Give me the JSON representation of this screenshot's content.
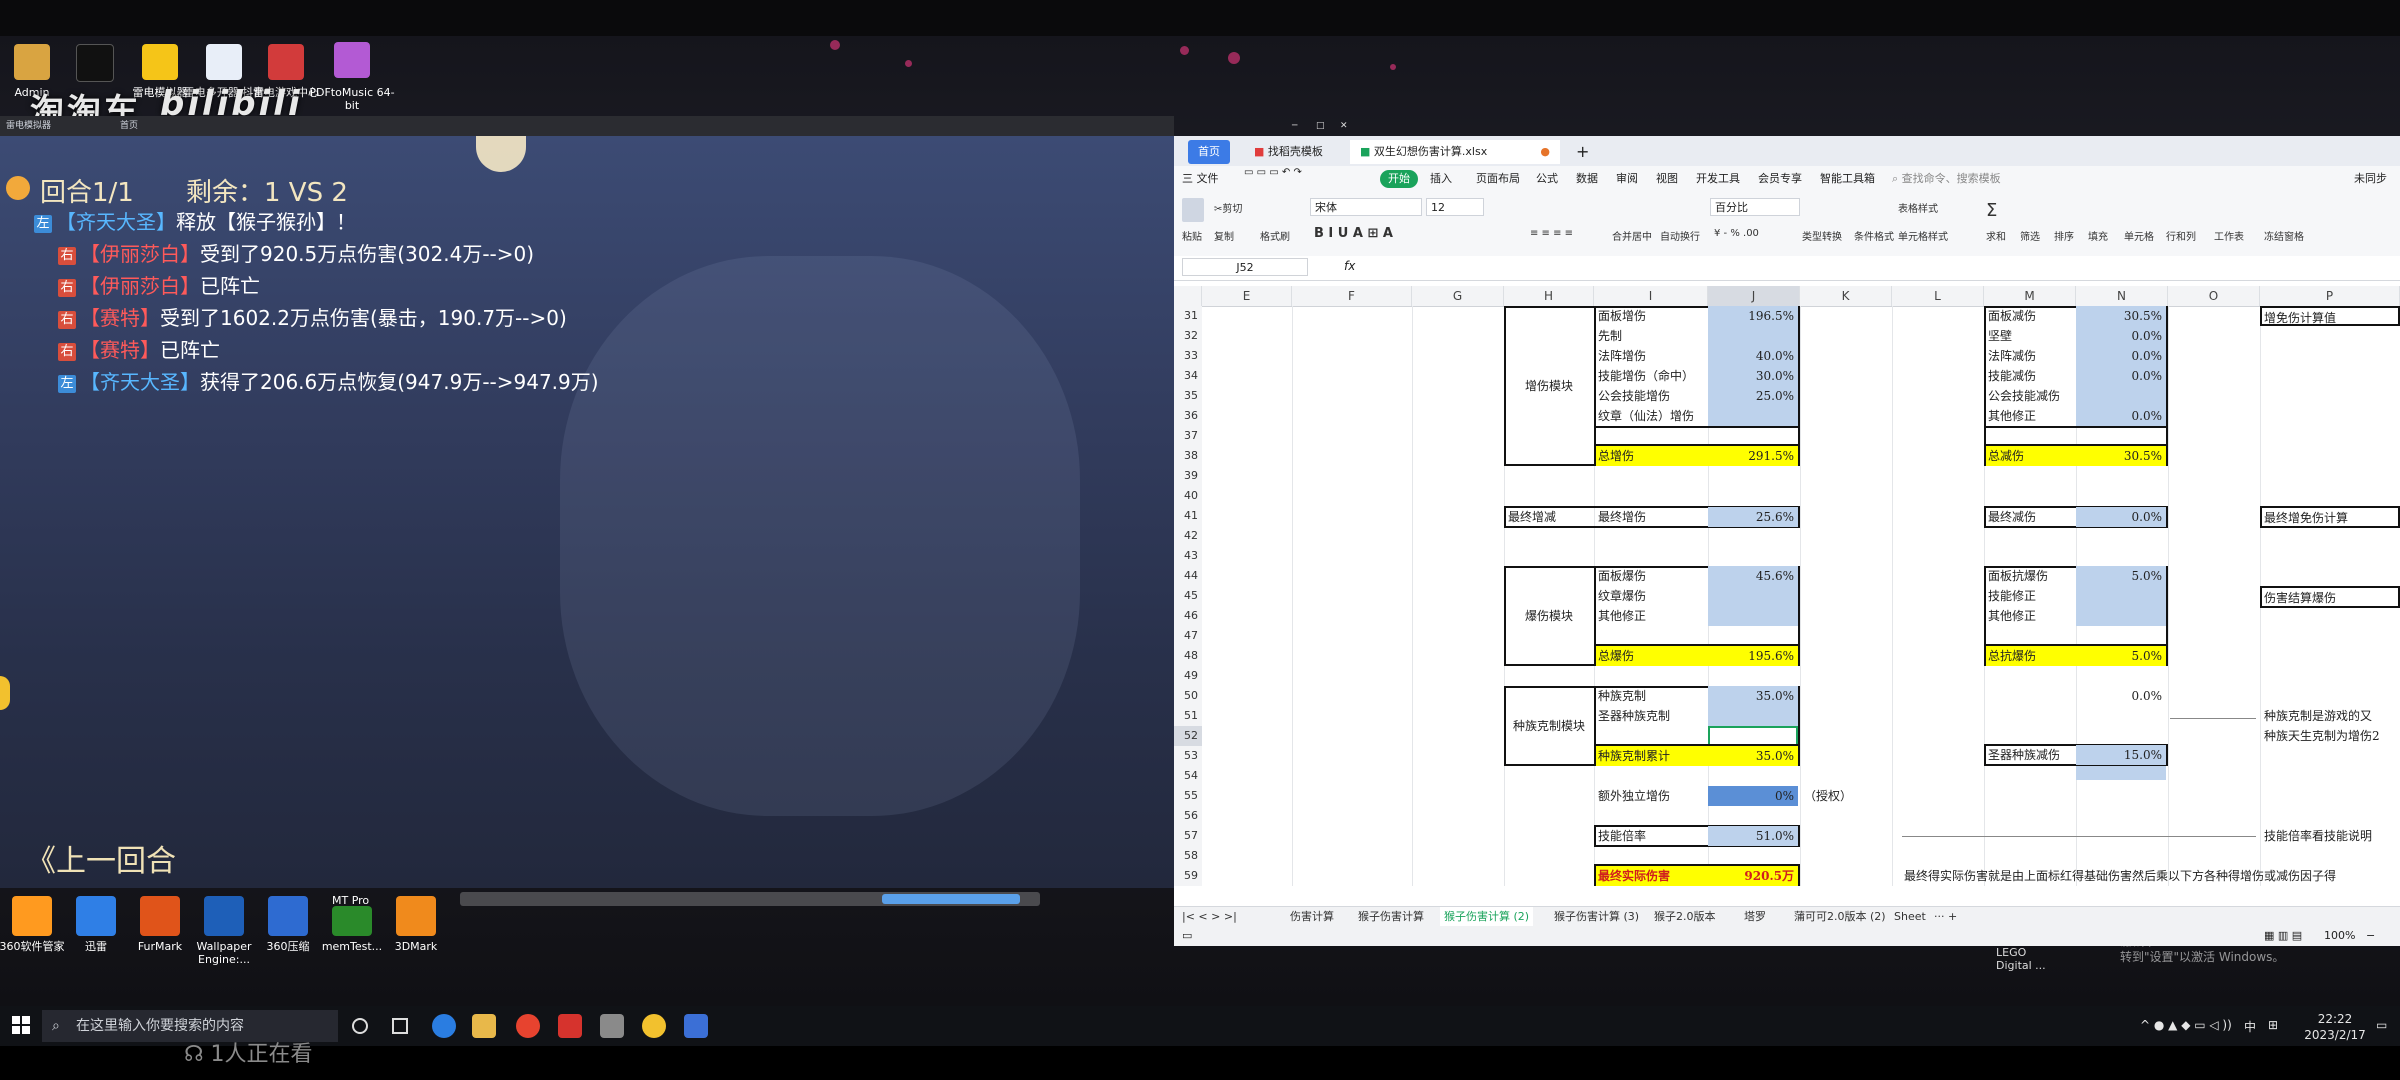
{
  "desktop": {
    "icons_top": [
      {
        "label": "Admin",
        "icon": "user-folder-icon",
        "color": "#d9a441"
      },
      {
        "label": "",
        "icon": "capcut-icon",
        "color": "#111111"
      },
      {
        "label": "雷电模拟器",
        "icon": "emulator-icon",
        "color": "#f5c518"
      },
      {
        "label": "雷电多开器 抖音",
        "icon": "document-icon",
        "color": "#2a6ed8"
      },
      {
        "label": "雷电游戏中心",
        "icon": "game-center-icon",
        "color": "#d23b3b"
      },
      {
        "label": "PDFtoMusic 64-bit",
        "icon": "music-icon",
        "color": "#b35ad4"
      }
    ],
    "watermark_taotao": "淘淘车",
    "watermark_bili": "bilibili",
    "icons_bottom": [
      {
        "label": "360软件管家",
        "icon": "software-manager-icon",
        "color": "#ff9a1f"
      },
      {
        "label": "迅雷",
        "icon": "thunder-icon",
        "color": "#2f7fe6"
      },
      {
        "label": "FurMark",
        "icon": "furmark-icon",
        "color": "#e0541a"
      },
      {
        "label": "Wallpaper Engine:...",
        "icon": "wallpaper-engine-icon",
        "color": "#1e5fb8"
      },
      {
        "label": "360压缩",
        "icon": "archive-icon",
        "color": "#2e6bd1"
      },
      {
        "label": "memTest...",
        "icon": "memtest-icon",
        "color": "#2a8a2a"
      },
      {
        "label": "3DMark",
        "icon": "3dmark-icon",
        "color": "#f08a1c"
      }
    ],
    "mt_pro_label": "MT Pro",
    "lego_label": "LEGO Digital ...",
    "activate_windows_1": "激活 Windows",
    "activate_windows_2": "转到\"设置\"以激活 Windows。"
  },
  "game": {
    "titlebar_left": "雷电模拟器",
    "titlebar_tab": "首页",
    "round": "回合1/1",
    "remaining": "剩余：1 VS 2",
    "log": [
      {
        "side": "left",
        "tag": "左",
        "name": "【齐天大圣】",
        "text": "释放【猴子猴孙】！"
      },
      {
        "side": "right",
        "tag": "右",
        "name": "【伊丽莎白】",
        "text": "受到了920.5万点伤害(302.4万-->0)"
      },
      {
        "side": "right",
        "tag": "右",
        "name": "【伊丽莎白】",
        "text": "已阵亡"
      },
      {
        "side": "right",
        "tag": "右",
        "name": "【赛特】",
        "text": "受到了1602.2万点伤害(暴击，190.7万-->0)"
      },
      {
        "side": "right",
        "tag": "右",
        "name": "【赛特】",
        "text": "已阵亡"
      },
      {
        "side": "left",
        "tag": "左",
        "name": "【齐天大圣】",
        "text": "获得了206.6万点恢复(947.9万-->947.9万)"
      }
    ],
    "prev_round": "《上一回合"
  },
  "wps": {
    "tabs": [
      {
        "label": "首页"
      },
      {
        "label": "找稻壳模板"
      },
      {
        "label": "双生幻想伤害计算.xlsx"
      }
    ],
    "menu": [
      "三 文件",
      "开始",
      "插入",
      "页面布局",
      "公式",
      "数据",
      "审阅",
      "视图",
      "开发工具",
      "会员专享",
      "智能工具箱"
    ],
    "search_placeholder": "查找命令、搜索模板",
    "share_label": "未同步",
    "ribbon": {
      "cut": "剪切",
      "paste": "粘贴",
      "copy": "复制",
      "format_painter": "格式刷",
      "font": "宋体",
      "size": "12",
      "merge": "合并居中",
      "wrap": "自动换行",
      "number_format": "百分比",
      "type_convert": "类型转换",
      "cond_format": "条件格式",
      "table_style": "表格样式",
      "cell_style": "单元格样式",
      "sum": "求和",
      "filter": "筛选",
      "sort": "排序",
      "fill": "填充",
      "cell": "单元格",
      "rowcol": "行和列",
      "sheet": "工作表",
      "freeze": "冻结窗格"
    },
    "name_box": "J52",
    "fx": "fx",
    "columns": [
      "E",
      "F",
      "G",
      "H",
      "I",
      "J",
      "K",
      "L",
      "M",
      "N",
      "O",
      "P"
    ],
    "rows": [
      "31",
      "32",
      "33",
      "34",
      "35",
      "36",
      "37",
      "38",
      "39",
      "40",
      "41",
      "42",
      "43",
      "44",
      "45",
      "46",
      "47",
      "48",
      "49",
      "50",
      "51",
      "52",
      "53",
      "54",
      "55",
      "56",
      "57",
      "58",
      "59"
    ],
    "cells": {
      "h_zengshang": "增伤模块",
      "i31": "面板增伤",
      "j31": "196.5%",
      "i32": "先制",
      "i33": "法阵增伤",
      "j33": "40.0%",
      "i34": "技能增伤（命中）",
      "j34": "30.0%",
      "i35": "公会技能增伤",
      "j35": "25.0%",
      "i36": "纹章（仙法）增伤",
      "i38": "总增伤",
      "j38": "291.5%",
      "m31": "面板减伤",
      "n31": "30.5%",
      "m32": "坚壁",
      "n32": "0.0%",
      "m33": "法阵减伤",
      "n33": "0.0%",
      "m34": "技能减伤",
      "n34": "0.0%",
      "m35": "公会技能减伤",
      "m36": "其他修正",
      "n36": "0.0%",
      "m38": "总减伤",
      "n38": "30.5%",
      "p31": "增免伤计算值",
      "h41": "最终增减",
      "i41": "最终增伤",
      "j41": "25.6%",
      "m41": "最终减伤",
      "n41": "0.0%",
      "p41": "最终增免伤计算",
      "h_baoshang": "爆伤模块",
      "i44": "面板爆伤",
      "j44": "45.6%",
      "i45": "纹章爆伤",
      "i46": "其他修正",
      "i48": "总爆伤",
      "j48": "195.6%",
      "m44": "面板抗爆伤",
      "n44": "5.0%",
      "m45": "技能修正",
      "m46": "其他修正",
      "m48": "总抗爆伤",
      "n48": "5.0%",
      "p45": "伤害结算爆伤",
      "h_zhongzu": "种族克制模块",
      "i50": "种族克制",
      "j50": "35.0%",
      "i51": "圣器种族克制",
      "i53": "种族克制累计",
      "j53": "35.0%",
      "n50": "0.0%",
      "m53": "圣器种族减伤",
      "n53": "15.0%",
      "p51": "种族克制是游戏的又",
      "p52": "种族天生克制为增伤2",
      "i55": "额外独立增伤",
      "j55": "0%",
      "k55": "（授权）",
      "i57": "技能倍率",
      "j57": "51.0%",
      "p57": "技能倍率看技能说明",
      "i59": "最终实际伤害",
      "j59": "920.5万",
      "l59": "最终得实际伤害就是由上面标红得基础伤害然后乘以下方各种得增伤或减伤因子得"
    },
    "sheet_tabs": [
      "伤害计算",
      "猴子伤害计算",
      "猴子伤害计算 (2)",
      "猴子伤害计算 (3)",
      "猴子2.0版本",
      "塔罗",
      "蒲可可2.0版本 (2)",
      "Sheet"
    ],
    "active_sheet_index": 2,
    "zoom": "100%"
  },
  "taskbar": {
    "search_placeholder": "在这里输入你要搜索的内容",
    "ime": "中",
    "time": "22:22",
    "date": "2023/2/17"
  },
  "overlay": {
    "viewers": "1人正在看"
  }
}
